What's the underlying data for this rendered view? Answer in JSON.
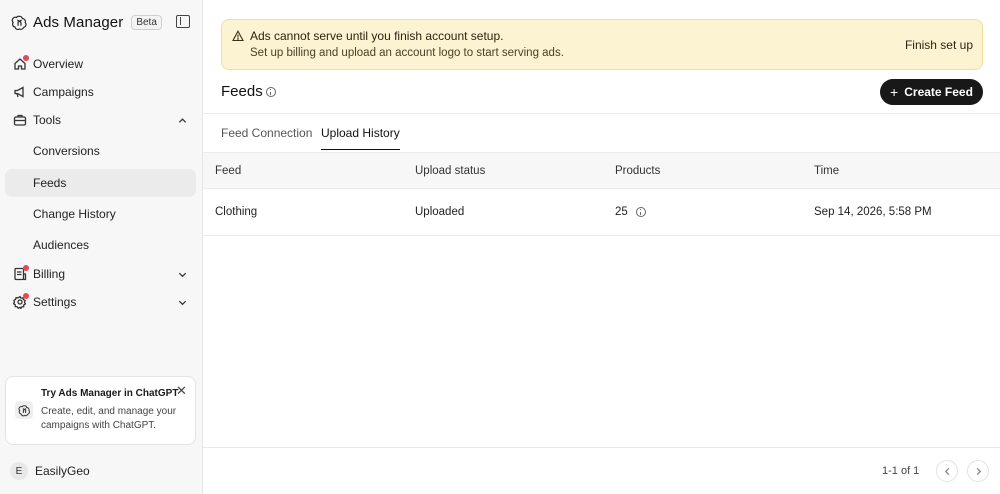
{
  "app": {
    "name": "Ads Manager",
    "badge": "Beta"
  },
  "sidebar": {
    "items": [
      {
        "label": "Overview",
        "icon": "home-icon",
        "dot": true
      },
      {
        "label": "Campaigns",
        "icon": "megaphone-icon",
        "dot": false
      },
      {
        "label": "Tools",
        "icon": "toolbox-icon",
        "dot": false,
        "expanded": true
      },
      {
        "label": "Conversions",
        "sub": true
      },
      {
        "label": "Feeds",
        "sub": true,
        "active": true
      },
      {
        "label": "Change History",
        "sub": true
      },
      {
        "label": "Audiences",
        "sub": true
      },
      {
        "label": "Billing",
        "icon": "receipt-icon",
        "dot": true,
        "expanded": false
      },
      {
        "label": "Settings",
        "icon": "gear-icon",
        "dot": true,
        "expanded": false
      }
    ]
  },
  "promo": {
    "title": "Try Ads Manager in ChatGPT",
    "body": "Create, edit, and manage your campaigns with ChatGPT."
  },
  "user": {
    "initial": "E",
    "name": "EasilyGeo"
  },
  "banner": {
    "title": "Ads cannot serve until you finish account setup.",
    "body": "Set up billing and upload an account logo to start serving ads.",
    "action": "Finish set up"
  },
  "page": {
    "title": "Feeds",
    "create_button": "Create Feed"
  },
  "tabs": [
    {
      "label": "Feed Connection",
      "active": false
    },
    {
      "label": "Upload History",
      "active": true
    }
  ],
  "table": {
    "columns": [
      "Feed",
      "Upload status",
      "Products",
      "Time"
    ],
    "rows": [
      {
        "feed": "Clothing",
        "status": "Uploaded",
        "products": "25",
        "time": "Sep 14, 2026, 5:58 PM"
      }
    ]
  },
  "pagination": {
    "text": "1-1 of 1"
  },
  "colors": {
    "accent": "#181818",
    "banner_bg": "#fcf3d2",
    "notification_dot": "#e5484d"
  }
}
